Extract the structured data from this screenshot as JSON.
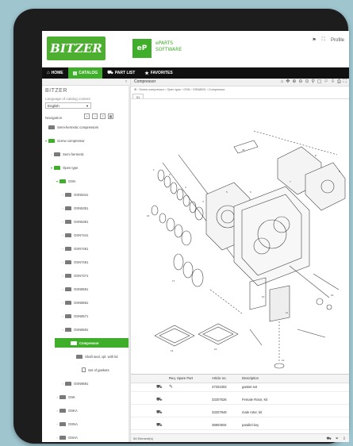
{
  "header": {
    "logo": "BITZER",
    "eparts_box": "eP",
    "eparts_line1": "ePARTS",
    "eparts_line2": "SOFTWARE",
    "right_flag": "⚑",
    "right_expand": "⛶",
    "right_profile": "Profile"
  },
  "nav": {
    "items": [
      {
        "label": "HOME",
        "icon": "home-icon"
      },
      {
        "label": "CATALOG",
        "icon": "book-icon"
      },
      {
        "label": "PART LIST",
        "icon": "cart-icon"
      },
      {
        "label": "FAVORITES",
        "icon": "star-icon"
      }
    ]
  },
  "sidebar": {
    "collapse": "‹",
    "brand": "BITZER",
    "language_label": "Language of catalog content",
    "language_value": "English",
    "navigation_label": "Navigation",
    "tree": [
      {
        "label": "Semi-hermetic compressors",
        "level": 0
      },
      {
        "label": "Screw compressor",
        "level": 0
      },
      {
        "label": "Semi hermetic",
        "level": 1
      },
      {
        "label": "Open type",
        "level": 1
      },
      {
        "label": "OSN",
        "level": 2
      },
      {
        "label": "OSN5341",
        "level": 3
      },
      {
        "label": "OSN5351",
        "level": 3
      },
      {
        "label": "OSN5361",
        "level": 3
      },
      {
        "label": "OSN7441",
        "level": 3
      },
      {
        "label": "OSN7451",
        "level": 3
      },
      {
        "label": "OSN7461",
        "level": 3
      },
      {
        "label": "OSN7471",
        "level": 3
      },
      {
        "label": "OSN8551",
        "level": 3
      },
      {
        "label": "OSN8561",
        "level": 3
      },
      {
        "label": "OSN8571",
        "level": 3
      },
      {
        "label": "OSN8591",
        "level": 3
      },
      {
        "label": "Compressor",
        "level": 4
      },
      {
        "label": "Shaft seal, cpl. with lid",
        "level": 5
      },
      {
        "label": "Set of gaskets",
        "level": 6
      },
      {
        "label": "OSN9591",
        "level": 3
      },
      {
        "label": "OSK",
        "level": 2
      },
      {
        "label": "OSKA",
        "level": 2
      },
      {
        "label": "OSNA",
        "level": 2
      },
      {
        "label": "OSHA",
        "level": 2
      }
    ]
  },
  "main": {
    "title": "Compressor",
    "breadcrumb": "⊕  ›  Screw compressor  ›  Open type  ›  OSN  ›  OSN8591  ›  Compressor",
    "tab": "01",
    "table": {
      "headers": [
        "",
        "",
        "Req. Spare Part",
        "Article no.",
        "Description"
      ],
      "rows": [
        {
          "article": "37202303",
          "description": "gasket set"
        },
        {
          "article": "33207526",
          "description": "Female Rotor, Kit"
        },
        {
          "article": "33207949",
          "description": "male rotor, kit"
        },
        {
          "article": "38803934",
          "description": "parallel key"
        }
      ],
      "footer_left": "54 Element(s)",
      "footer_icons": [
        "cart-icon",
        "filter-icon",
        "download-icon"
      ]
    }
  },
  "colors": {
    "accent": "#3fae2a",
    "navbar": "#111111"
  }
}
